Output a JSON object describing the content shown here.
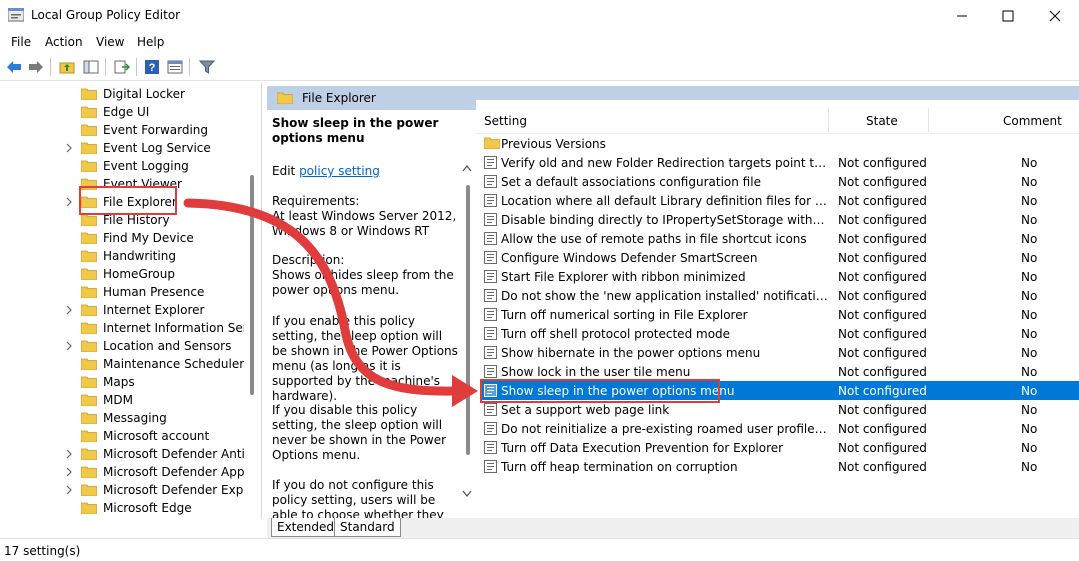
{
  "window": {
    "title": "Local Group Policy Editor",
    "icon": "group-policy-icon"
  },
  "menu": [
    "File",
    "Action",
    "View",
    "Help"
  ],
  "toolbar": {
    "icons": [
      "back-arrow-icon",
      "forward-arrow-icon",
      "up-folder-icon",
      "show-hide-tree-icon",
      "export-list-icon",
      "help-icon",
      "properties-icon",
      "filter-icon"
    ]
  },
  "tree": {
    "items": [
      {
        "label": "Digital Locker",
        "expandable": false
      },
      {
        "label": "Edge UI",
        "expandable": false
      },
      {
        "label": "Event Forwarding",
        "expandable": false
      },
      {
        "label": "Event Log Service",
        "expandable": true
      },
      {
        "label": "Event Logging",
        "expandable": false
      },
      {
        "label": "Event Viewer",
        "expandable": false
      },
      {
        "label": "File Explorer",
        "expandable": true,
        "selected": true
      },
      {
        "label": "File History",
        "expandable": false
      },
      {
        "label": "Find My Device",
        "expandable": false
      },
      {
        "label": "Handwriting",
        "expandable": false
      },
      {
        "label": "HomeGroup",
        "expandable": false
      },
      {
        "label": "Human Presence",
        "expandable": false
      },
      {
        "label": "Internet Explorer",
        "expandable": true
      },
      {
        "label": "Internet Information Servic",
        "expandable": false
      },
      {
        "label": "Location and Sensors",
        "expandable": true
      },
      {
        "label": "Maintenance Scheduler",
        "expandable": false
      },
      {
        "label": "Maps",
        "expandable": false
      },
      {
        "label": "MDM",
        "expandable": false
      },
      {
        "label": "Messaging",
        "expandable": false
      },
      {
        "label": "Microsoft account",
        "expandable": false
      },
      {
        "label": "Microsoft Defender Antivir",
        "expandable": true
      },
      {
        "label": "Microsoft Defender Applic",
        "expandable": true
      },
      {
        "label": "Microsoft Defender Exploit",
        "expandable": true
      },
      {
        "label": "Microsoft Edge",
        "expandable": false
      }
    ]
  },
  "header": {
    "title": "File Explorer"
  },
  "description": {
    "title": "Show sleep in the power options menu",
    "edit_prefix": "Edit ",
    "edit_link": "policy setting ",
    "requirements_label": "Requirements:",
    "requirements": "At least Windows Server 2012, Windows 8 or Windows RT",
    "description_label": "Description:",
    "description": "Shows or hides sleep from the power options menu.",
    "enable_text": "If you enable this policy setting, the sleep option will be shown in the Power Options menu (as long as it is supported by the machine's hardware).",
    "disable_text": "If you disable this policy setting, the sleep option will never be shown in the Power Options menu.",
    "notconfig_text": "If you do not configure this policy setting, users will be able to choose whether they want sleep"
  },
  "list": {
    "columns": {
      "setting": "Setting",
      "state": "State",
      "comment": "Comment"
    },
    "folder_row": "Previous Versions",
    "rows": [
      {
        "name": "Verify old and new Folder Redirection targets point to the sa...",
        "state": "Not configured",
        "comment": "No"
      },
      {
        "name": "Set a default associations configuration file",
        "state": "Not configured",
        "comment": "No"
      },
      {
        "name": "Location where all default Library definition files for users/m...",
        "state": "Not configured",
        "comment": "No"
      },
      {
        "name": "Disable binding directly to IPropertySetStorage without inter...",
        "state": "Not configured",
        "comment": "No"
      },
      {
        "name": "Allow the use of remote paths in file shortcut icons",
        "state": "Not configured",
        "comment": "No"
      },
      {
        "name": "Configure Windows Defender SmartScreen",
        "state": "Not configured",
        "comment": "No"
      },
      {
        "name": "Start File Explorer with ribbon minimized",
        "state": "Not configured",
        "comment": "No"
      },
      {
        "name": "Do not show the 'new application installed' notification",
        "state": "Not configured",
        "comment": "No"
      },
      {
        "name": "Turn off numerical sorting in File Explorer",
        "state": "Not configured",
        "comment": "No"
      },
      {
        "name": "Turn off shell protocol protected mode",
        "state": "Not configured",
        "comment": "No"
      },
      {
        "name": "Show hibernate in the power options menu",
        "state": "Not configured",
        "comment": "No"
      },
      {
        "name": "Show lock in the user tile menu",
        "state": "Not configured",
        "comment": "No"
      },
      {
        "name": "Show sleep in the power options menu",
        "state": "Not configured",
        "comment": "No",
        "selected": true
      },
      {
        "name": "Set a support web page link",
        "state": "Not configured",
        "comment": "No"
      },
      {
        "name": "Do not reinitialize a pre-existing roamed user profile when it...",
        "state": "Not configured",
        "comment": "No"
      },
      {
        "name": "Turn off Data Execution Prevention for Explorer",
        "state": "Not configured",
        "comment": "No"
      },
      {
        "name": "Turn off heap termination on corruption",
        "state": "Not configured",
        "comment": "No"
      }
    ]
  },
  "tabs": [
    "Extended",
    "Standard"
  ],
  "status": "17 setting(s)",
  "colors": {
    "selection": "#0078d7",
    "header_bar": "#bfcfe6",
    "annotation": "#e03c3c",
    "folder": "#f2c84b"
  }
}
